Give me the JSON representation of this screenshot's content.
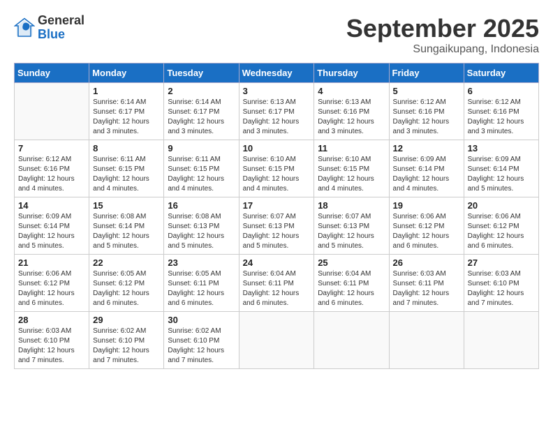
{
  "header": {
    "logo": {
      "general": "General",
      "blue": "Blue"
    },
    "title": "September 2025",
    "location": "Sungaikupang, Indonesia"
  },
  "weekdays": [
    "Sunday",
    "Monday",
    "Tuesday",
    "Wednesday",
    "Thursday",
    "Friday",
    "Saturday"
  ],
  "weeks": [
    [
      {
        "day": "",
        "empty": true
      },
      {
        "day": "1",
        "sunrise": "6:14 AM",
        "sunset": "6:17 PM",
        "daylight": "12 hours and 3 minutes."
      },
      {
        "day": "2",
        "sunrise": "6:14 AM",
        "sunset": "6:17 PM",
        "daylight": "12 hours and 3 minutes."
      },
      {
        "day": "3",
        "sunrise": "6:13 AM",
        "sunset": "6:17 PM",
        "daylight": "12 hours and 3 minutes."
      },
      {
        "day": "4",
        "sunrise": "6:13 AM",
        "sunset": "6:16 PM",
        "daylight": "12 hours and 3 minutes."
      },
      {
        "day": "5",
        "sunrise": "6:12 AM",
        "sunset": "6:16 PM",
        "daylight": "12 hours and 3 minutes."
      },
      {
        "day": "6",
        "sunrise": "6:12 AM",
        "sunset": "6:16 PM",
        "daylight": "12 hours and 3 minutes."
      }
    ],
    [
      {
        "day": "7",
        "sunrise": "6:12 AM",
        "sunset": "6:16 PM",
        "daylight": "12 hours and 4 minutes."
      },
      {
        "day": "8",
        "sunrise": "6:11 AM",
        "sunset": "6:15 PM",
        "daylight": "12 hours and 4 minutes."
      },
      {
        "day": "9",
        "sunrise": "6:11 AM",
        "sunset": "6:15 PM",
        "daylight": "12 hours and 4 minutes."
      },
      {
        "day": "10",
        "sunrise": "6:10 AM",
        "sunset": "6:15 PM",
        "daylight": "12 hours and 4 minutes."
      },
      {
        "day": "11",
        "sunrise": "6:10 AM",
        "sunset": "6:15 PM",
        "daylight": "12 hours and 4 minutes."
      },
      {
        "day": "12",
        "sunrise": "6:09 AM",
        "sunset": "6:14 PM",
        "daylight": "12 hours and 4 minutes."
      },
      {
        "day": "13",
        "sunrise": "6:09 AM",
        "sunset": "6:14 PM",
        "daylight": "12 hours and 5 minutes."
      }
    ],
    [
      {
        "day": "14",
        "sunrise": "6:09 AM",
        "sunset": "6:14 PM",
        "daylight": "12 hours and 5 minutes."
      },
      {
        "day": "15",
        "sunrise": "6:08 AM",
        "sunset": "6:14 PM",
        "daylight": "12 hours and 5 minutes."
      },
      {
        "day": "16",
        "sunrise": "6:08 AM",
        "sunset": "6:13 PM",
        "daylight": "12 hours and 5 minutes."
      },
      {
        "day": "17",
        "sunrise": "6:07 AM",
        "sunset": "6:13 PM",
        "daylight": "12 hours and 5 minutes."
      },
      {
        "day": "18",
        "sunrise": "6:07 AM",
        "sunset": "6:13 PM",
        "daylight": "12 hours and 5 minutes."
      },
      {
        "day": "19",
        "sunrise": "6:06 AM",
        "sunset": "6:12 PM",
        "daylight": "12 hours and 6 minutes."
      },
      {
        "day": "20",
        "sunrise": "6:06 AM",
        "sunset": "6:12 PM",
        "daylight": "12 hours and 6 minutes."
      }
    ],
    [
      {
        "day": "21",
        "sunrise": "6:06 AM",
        "sunset": "6:12 PM",
        "daylight": "12 hours and 6 minutes."
      },
      {
        "day": "22",
        "sunrise": "6:05 AM",
        "sunset": "6:12 PM",
        "daylight": "12 hours and 6 minutes."
      },
      {
        "day": "23",
        "sunrise": "6:05 AM",
        "sunset": "6:11 PM",
        "daylight": "12 hours and 6 minutes."
      },
      {
        "day": "24",
        "sunrise": "6:04 AM",
        "sunset": "6:11 PM",
        "daylight": "12 hours and 6 minutes."
      },
      {
        "day": "25",
        "sunrise": "6:04 AM",
        "sunset": "6:11 PM",
        "daylight": "12 hours and 6 minutes."
      },
      {
        "day": "26",
        "sunrise": "6:03 AM",
        "sunset": "6:11 PM",
        "daylight": "12 hours and 7 minutes."
      },
      {
        "day": "27",
        "sunrise": "6:03 AM",
        "sunset": "6:10 PM",
        "daylight": "12 hours and 7 minutes."
      }
    ],
    [
      {
        "day": "28",
        "sunrise": "6:03 AM",
        "sunset": "6:10 PM",
        "daylight": "12 hours and 7 minutes."
      },
      {
        "day": "29",
        "sunrise": "6:02 AM",
        "sunset": "6:10 PM",
        "daylight": "12 hours and 7 minutes."
      },
      {
        "day": "30",
        "sunrise": "6:02 AM",
        "sunset": "6:10 PM",
        "daylight": "12 hours and 7 minutes."
      },
      {
        "day": "",
        "empty": true
      },
      {
        "day": "",
        "empty": true
      },
      {
        "day": "",
        "empty": true
      },
      {
        "day": "",
        "empty": true
      }
    ]
  ]
}
